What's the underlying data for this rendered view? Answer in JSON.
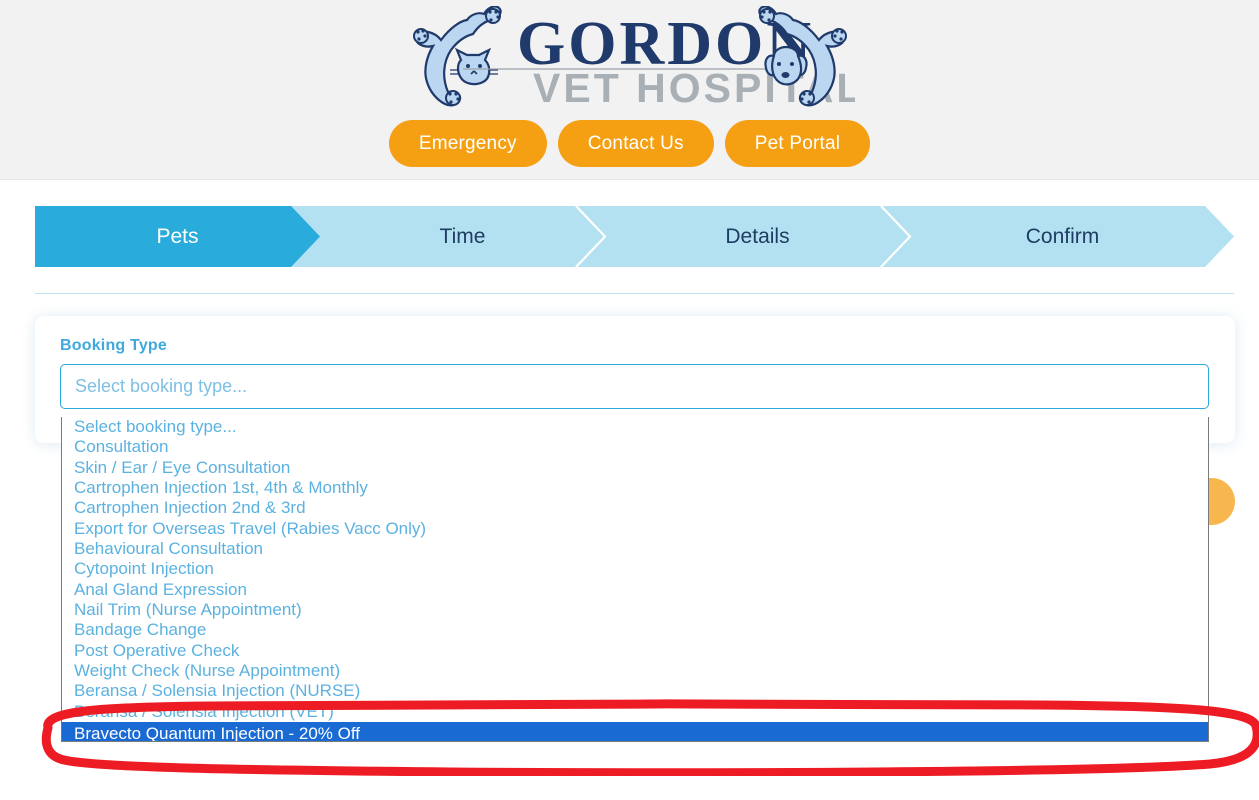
{
  "header": {
    "logo": {
      "name": "gordon-vet-hospital-logo",
      "primary_text": "GORDON",
      "secondary_text": "VET HOSPITAL",
      "primary_color": "#1F3A6B",
      "secondary_color": "#A8AFB5",
      "animal_fill": "#BBD6F0",
      "animal_stroke": "#1F3A6B"
    },
    "buttons": [
      {
        "name": "emergency",
        "label": "Emergency"
      },
      {
        "name": "contact-us",
        "label": "Contact Us"
      },
      {
        "name": "pet-portal",
        "label": "Pet Portal"
      }
    ],
    "button_color": "#F5A012",
    "background": "#f2f2f2"
  },
  "stepper": {
    "active_color": "#29ABDC",
    "inactive_color": "#B4E1F2",
    "active_text_color": "#FFFFFF",
    "inactive_text_color": "#1e3d63",
    "steps": [
      {
        "name": "pets",
        "label": "Pets",
        "active": true
      },
      {
        "name": "time",
        "label": "Time",
        "active": false
      },
      {
        "name": "details",
        "label": "Details",
        "active": false
      },
      {
        "name": "confirm",
        "label": "Confirm",
        "active": false
      }
    ]
  },
  "form": {
    "booking_type_label": "Booking Type",
    "booking_type_placeholder": "Select booking type...",
    "booking_type_value": "",
    "label_color": "#3FA9DE",
    "border_color": "#2BA8DC"
  },
  "dropdown": {
    "open": true,
    "text_color": "#5BB2E0",
    "highlight_background": "#1A6AD4",
    "highlight_text_color": "#FFFFFF",
    "selected_index": 15,
    "options": [
      "Select booking type...",
      "Consultation",
      "Skin / Ear / Eye Consultation",
      "Cartrophen Injection 1st, 4th & Monthly",
      "Cartrophen Injection 2nd & 3rd",
      "Export for Overseas Travel (Rabies Vacc Only)",
      "Behavioural Consultation",
      "Cytopoint Injection",
      "Anal Gland Expression",
      "Nail Trim (Nurse Appointment)",
      "Bandage Change",
      "Post Operative Check",
      "Weight Check (Nurse Appointment)",
      "Beransa / Solensia Injection (NURSE)",
      "Beransa / Solensia Injection (VET)",
      "Bravecto Quantum Injection - 20% Off"
    ]
  },
  "annotation": {
    "name": "red-ellipse-highlight",
    "color": "#ED1C24",
    "target": "Bravecto Quantum Injection - 20% Off"
  },
  "next_button": {
    "name": "next-step-button",
    "color": "#F7B64E"
  }
}
